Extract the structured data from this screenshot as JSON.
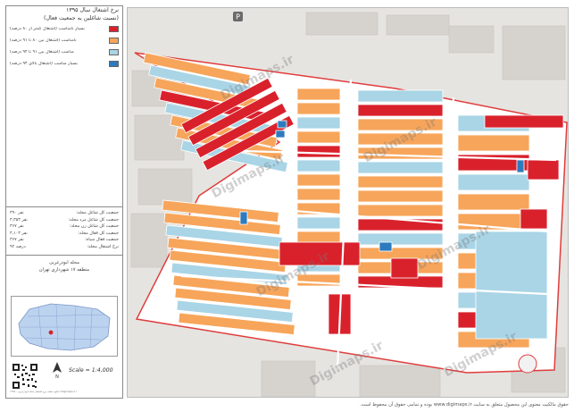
{
  "title": {
    "line1": "نرخ اشتغال سال ۱۳۹۵",
    "line2": "(نسبت شاغلین به جمعیت فعال)"
  },
  "legend": [
    {
      "label": "بسیار نامناسب (اشتغال کمتر از ۸۰ درصد)",
      "color": "#d9212c"
    },
    {
      "label": "نامناسب (اشتغال بین ۸۰ تا ۹۱ درصد)",
      "color": "#f7a55a"
    },
    {
      "label": "مناسب (اشتغال بین ۹۱ تا ۹۴ درصد)",
      "color": "#a9d5e6"
    },
    {
      "label": "بسیار مناسب (اشتغال بالای ۹۴ درصد)",
      "color": "#2c7bbf"
    }
  ],
  "stats": [
    {
      "label": "جمعیت کل شاغل محله:",
      "value": "۳۹۰ نفر"
    },
    {
      "label": "جمعیت کل شاغل مرد محله:",
      "value": "۳,۳۵۳ نفر"
    },
    {
      "label": "جمعیت کل شاغل زن محله:",
      "value": "۳۶۷ نفر"
    },
    {
      "label": "جمعیت کل فعال محله:",
      "value": "۴,۱۰۳ نفر"
    },
    {
      "label": "جمعیت فعال سیاه:",
      "value": "۳۶۷ نفر"
    },
    {
      "label": "نرخ اشتغال محله:",
      "value": "۹۲ درصد"
    }
  ],
  "caption": {
    "line1": "محله ابوذرغربی",
    "line2": "منطقه ۱۷ شهرداری تهران"
  },
  "scale": "Scale = 1:4,000",
  "watermark": "Digimaps.ir",
  "footer": "حقوق مالکیت معنوی این محصول متعلق به سایت www.digimaps.ir بوده و تمامی حقوق آن محفوظ است.",
  "tiny_text": "دانلود نقشه نرخ اشتغال محله ابوذرغربی - ۱۳۹۵ (Digimaps.ir)",
  "colors": {
    "very_bad": "#d9212c",
    "bad": "#f7a55a",
    "good": "#a9d5e6",
    "very_good": "#2c7bbf",
    "boundary": "#e03d3d",
    "ground": "#e6e4e0"
  }
}
